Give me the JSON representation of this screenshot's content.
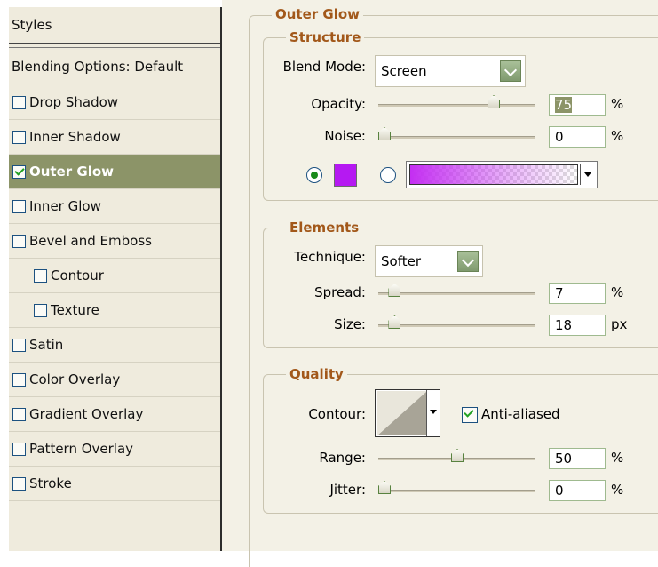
{
  "sidebar": {
    "title": "Styles",
    "blending": "Blending Options: Default",
    "items": [
      {
        "label": "Drop Shadow",
        "checked": false,
        "selected": false
      },
      {
        "label": "Inner Shadow",
        "checked": false,
        "selected": false
      },
      {
        "label": "Outer Glow",
        "checked": true,
        "selected": true
      },
      {
        "label": "Inner Glow",
        "checked": false,
        "selected": false
      },
      {
        "label": "Bevel and Emboss",
        "checked": false,
        "selected": false
      },
      {
        "label": "Contour",
        "checked": false,
        "selected": false,
        "indent": true
      },
      {
        "label": "Texture",
        "checked": false,
        "selected": false,
        "indent": true
      },
      {
        "label": "Satin",
        "checked": false,
        "selected": false
      },
      {
        "label": "Color Overlay",
        "checked": false,
        "selected": false
      },
      {
        "label": "Gradient Overlay",
        "checked": false,
        "selected": false
      },
      {
        "label": "Pattern Overlay",
        "checked": false,
        "selected": false
      },
      {
        "label": "Stroke",
        "checked": false,
        "selected": false
      }
    ]
  },
  "outer_glow": {
    "title": "Outer Glow",
    "structure": {
      "title": "Structure",
      "blend_mode_label": "Blend Mode:",
      "blend_mode": "Screen",
      "opacity_label": "Opacity:",
      "opacity": "75",
      "opacity_level": 0.75,
      "opacity_unit": "%",
      "noise_label": "Noise:",
      "noise": "0",
      "noise_level": 0,
      "noise_unit": "%",
      "color": "#b519f2",
      "gradient_from": "#c42ef2",
      "color_mode": "solid"
    },
    "elements": {
      "title": "Elements",
      "technique_label": "Technique:",
      "technique": "Softer",
      "spread_label": "Spread:",
      "spread": "7",
      "spread_level": 0.07,
      "spread_unit": "%",
      "size_label": "Size:",
      "size": "18",
      "size_level": 0.07,
      "size_unit": "px"
    },
    "quality": {
      "title": "Quality",
      "contour_label": "Contour:",
      "anti_aliased_label": "Anti-aliased",
      "anti_aliased": true,
      "range_label": "Range:",
      "range": "50",
      "range_level": 0.5,
      "range_unit": "%",
      "jitter_label": "Jitter:",
      "jitter": "0",
      "jitter_level": 0,
      "jitter_unit": "%"
    }
  },
  "colors": {
    "selected_row": "#8c9468",
    "section_title": "#a2581a",
    "check_mark": "#21a121"
  }
}
